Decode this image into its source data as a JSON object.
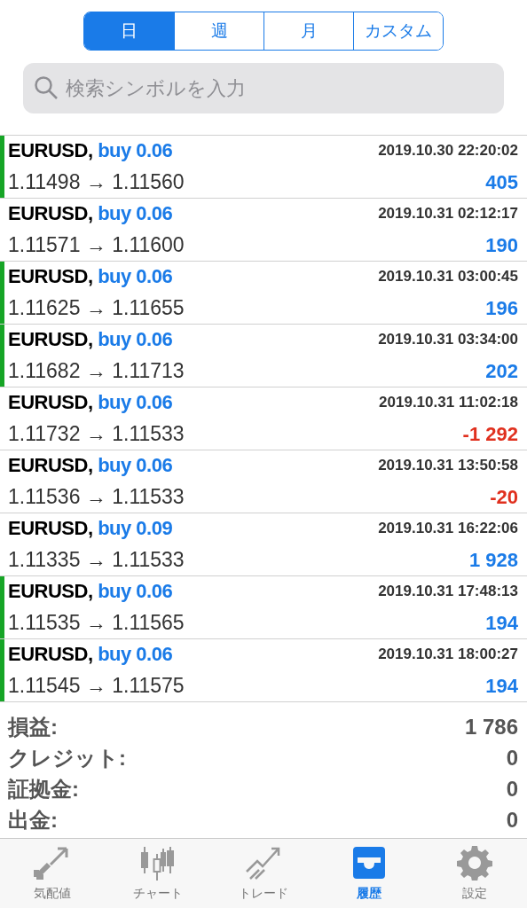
{
  "period_tabs": [
    {
      "label": "日",
      "selected": true
    },
    {
      "label": "週",
      "selected": false
    },
    {
      "label": "月",
      "selected": false
    },
    {
      "label": "カスタム",
      "selected": false
    }
  ],
  "search": {
    "placeholder": "検索シンボルを入力"
  },
  "deals": [
    {
      "symbol": "EURUSD,",
      "side": "buy 0.06",
      "time": "2019.10.30 22:20:02",
      "prices": "1.11498 → 1.11560",
      "profit": "405",
      "negative": false,
      "marked": true
    },
    {
      "symbol": "EURUSD,",
      "side": "buy 0.06",
      "time": "2019.10.31 02:12:17",
      "prices": "1.11571 → 1.11600",
      "profit": "190",
      "negative": false,
      "marked": false
    },
    {
      "symbol": "EURUSD,",
      "side": "buy 0.06",
      "time": "2019.10.31 03:00:45",
      "prices": "1.11625 → 1.11655",
      "profit": "196",
      "negative": false,
      "marked": true
    },
    {
      "symbol": "EURUSD,",
      "side": "buy 0.06",
      "time": "2019.10.31 03:34:00",
      "prices": "1.11682 → 1.11713",
      "profit": "202",
      "negative": false,
      "marked": true
    },
    {
      "symbol": "EURUSD,",
      "side": "buy 0.06",
      "time": "2019.10.31 11:02:18",
      "prices": "1.11732 → 1.11533",
      "profit": "-1 292",
      "negative": true,
      "marked": false
    },
    {
      "symbol": "EURUSD,",
      "side": "buy 0.06",
      "time": "2019.10.31 13:50:58",
      "prices": "1.11536 → 1.11533",
      "profit": "-20",
      "negative": true,
      "marked": false
    },
    {
      "symbol": "EURUSD,",
      "side": "buy 0.09",
      "time": "2019.10.31 16:22:06",
      "prices": "1.11335 → 1.11533",
      "profit": "1 928",
      "negative": false,
      "marked": false
    },
    {
      "symbol": "EURUSD,",
      "side": "buy 0.06",
      "time": "2019.10.31 17:48:13",
      "prices": "1.11535 → 1.11565",
      "profit": "194",
      "negative": false,
      "marked": true
    },
    {
      "symbol": "EURUSD,",
      "side": "buy 0.06",
      "time": "2019.10.31 18:00:27",
      "prices": "1.11545 → 1.11575",
      "profit": "194",
      "negative": false,
      "marked": true
    }
  ],
  "summary": [
    {
      "label": "損益:",
      "value": "1 786"
    },
    {
      "label": "クレジット:",
      "value": "0"
    },
    {
      "label": "証拠金:",
      "value": "0"
    },
    {
      "label": "出金:",
      "value": "0"
    }
  ],
  "tab_bar": [
    {
      "kind": "quotes",
      "label": "気配値",
      "selected": false
    },
    {
      "kind": "chart",
      "label": "チャート",
      "selected": false
    },
    {
      "kind": "trade",
      "label": "トレード",
      "selected": false
    },
    {
      "kind": "history",
      "label": "履歴",
      "selected": true
    },
    {
      "kind": "settings",
      "label": "設定",
      "selected": false
    }
  ]
}
